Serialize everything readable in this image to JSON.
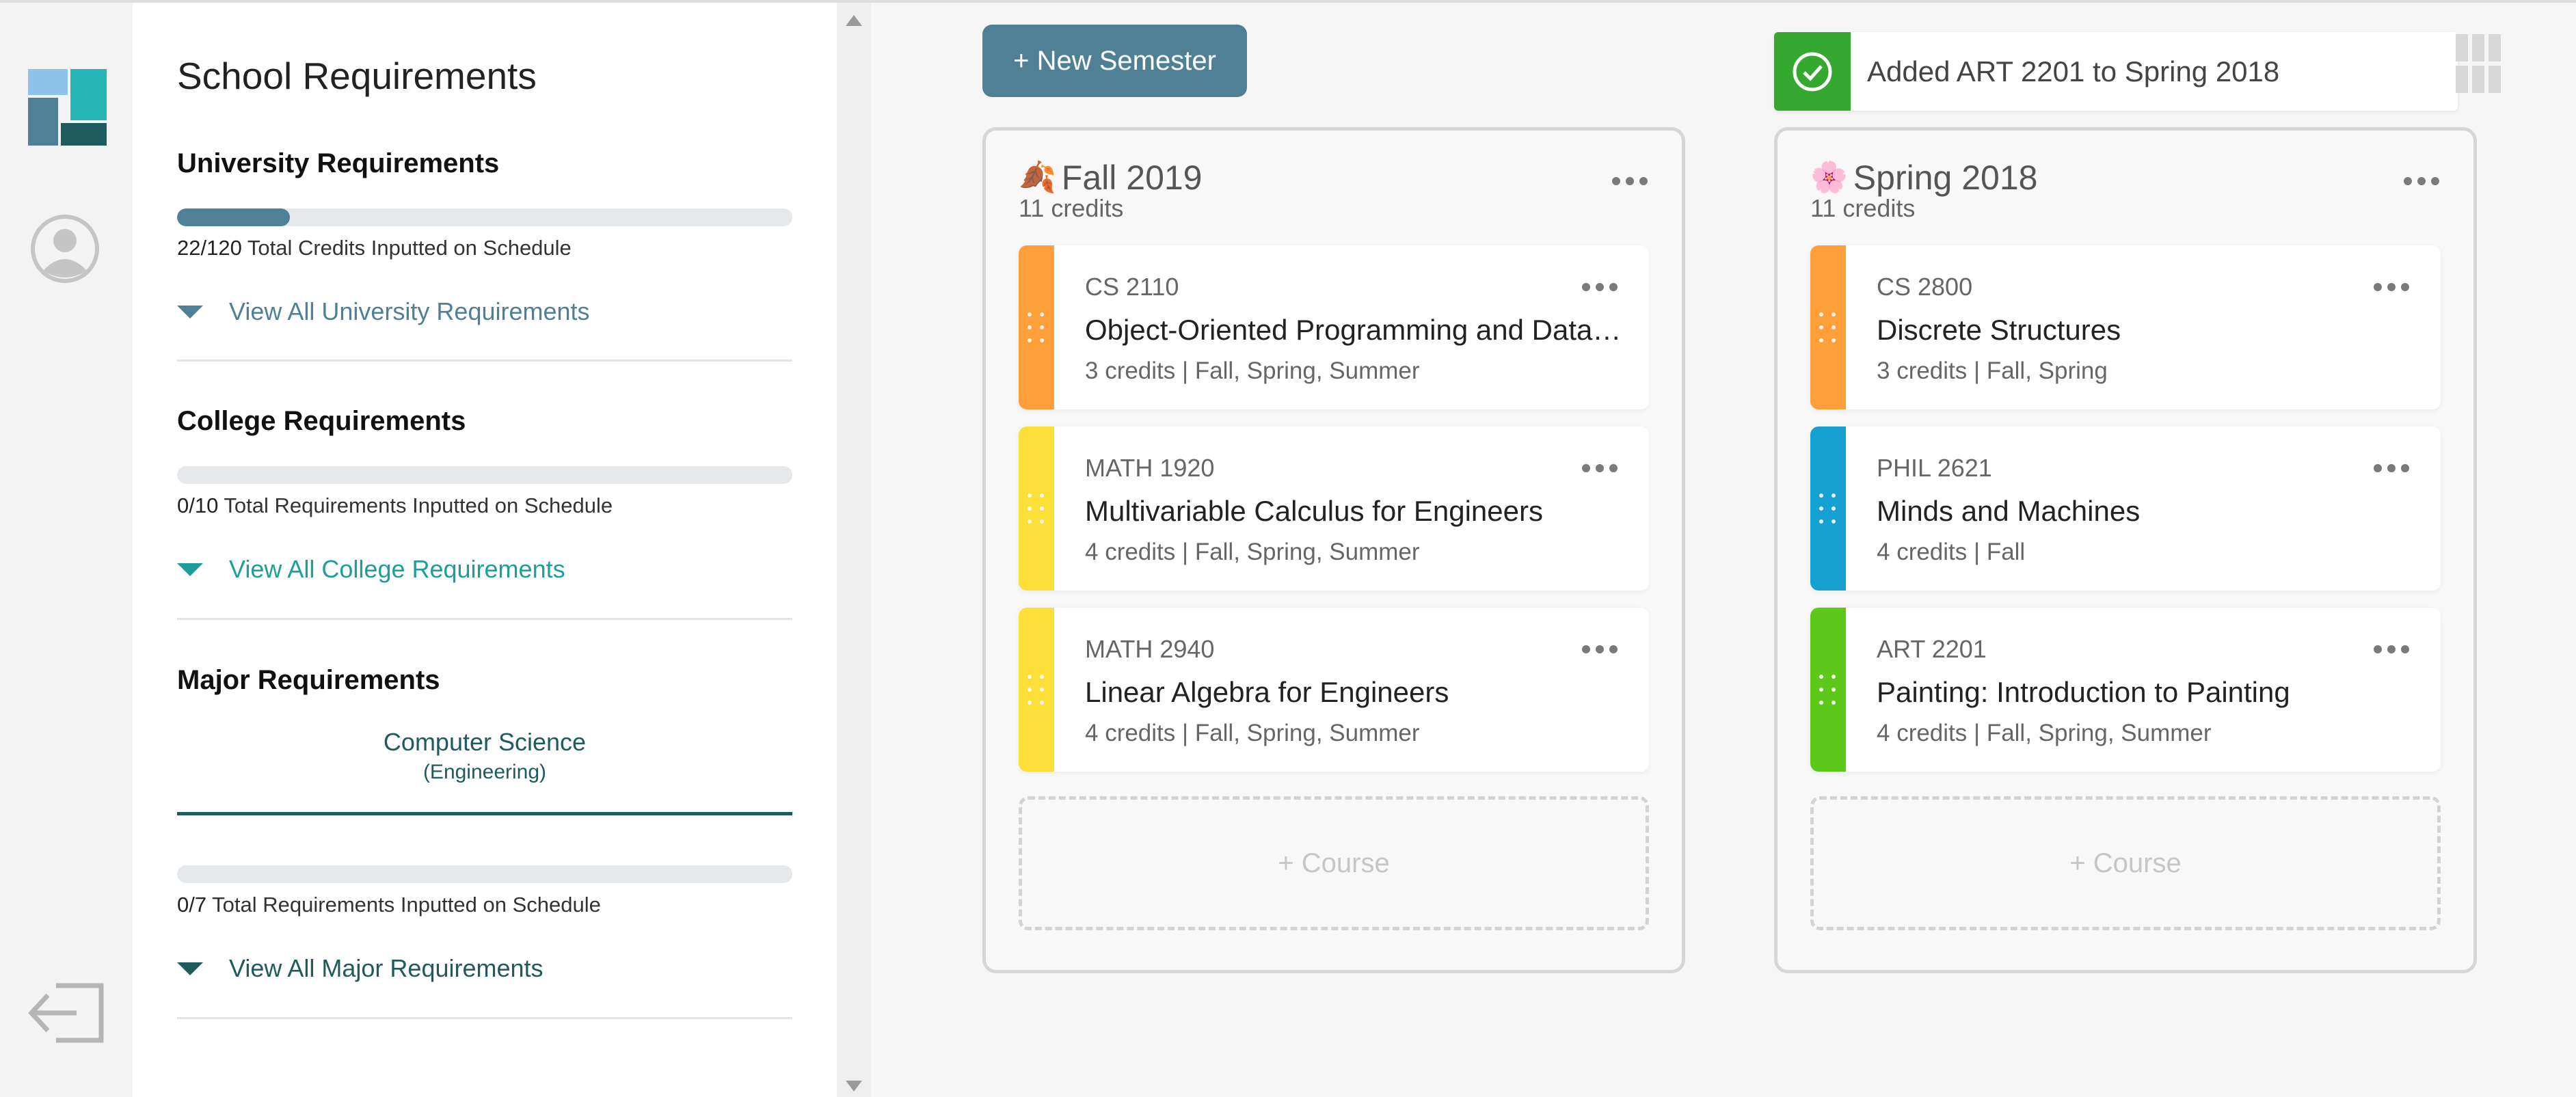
{
  "requirements": {
    "title": "School Requirements",
    "university": {
      "title": "University Requirements",
      "progress_done": "22/120",
      "progress_label": " Total Credits Inputted on Schedule",
      "progress_fraction": 0.183,
      "link": "View All University Requirements",
      "color": "#4f8096"
    },
    "college": {
      "title": "College Requirements",
      "progress_done": "0/10",
      "progress_label": " Total Requirements Inputted on Schedule",
      "progress_fraction": 0,
      "link": "View All College Requirements",
      "color": "#1e9e9a"
    },
    "major": {
      "title": "Major Requirements",
      "tab_name": "Computer Science",
      "tab_sub": "(Engineering)",
      "progress_done": "0/7",
      "progress_label": " Total Requirements Inputted on Schedule",
      "progress_fraction": 0,
      "link": "View All Major Requirements",
      "color": "#1f5a5c"
    }
  },
  "toolbar": {
    "new_semester": "+ New Semester"
  },
  "toast": {
    "message": "Added ART 2201 to Spring 2018",
    "color": "#34a82f"
  },
  "semesters": [
    {
      "name": "Fall 2019",
      "emoji": "🍂",
      "credits": "11 credits",
      "add_course": "+ Course",
      "courses": [
        {
          "code": "CS 2110",
          "name": "Object-Oriented Programming and Data Structures",
          "meta": "3 credits | Fall, Spring, Summer",
          "color": "#ff9f3a"
        },
        {
          "code": "MATH 1920",
          "name": "Multivariable Calculus for Engineers",
          "meta": "4 credits | Fall, Spring, Summer",
          "color": "#fddf3a"
        },
        {
          "code": "MATH 2940",
          "name": "Linear Algebra for Engineers",
          "meta": "4 credits | Fall, Spring, Summer",
          "color": "#fddf3a"
        }
      ]
    },
    {
      "name": "Spring 2018",
      "emoji": "🌸",
      "credits": "11 credits",
      "add_course": "+ Course",
      "courses": [
        {
          "code": "CS 2800",
          "name": "Discrete Structures",
          "meta": "3 credits | Fall, Spring",
          "color": "#ff9f3a"
        },
        {
          "code": "PHIL 2621",
          "name": "Minds and Machines",
          "meta": "4 credits | Fall",
          "color": "#17a1d3"
        },
        {
          "code": "ART 2201",
          "name": "Painting: Introduction to Painting",
          "meta": "4 credits | Fall, Spring, Summer",
          "color": "#5bc81a"
        }
      ]
    }
  ]
}
